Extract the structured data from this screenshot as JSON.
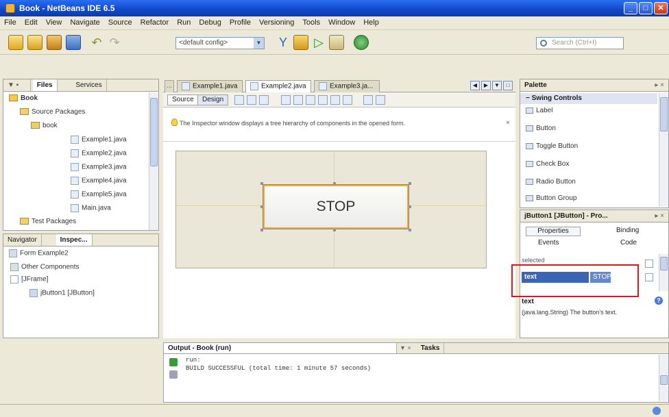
{
  "window": {
    "title": "Book - NetBeans IDE 6.5"
  },
  "menu": [
    "File",
    "Edit",
    "View",
    "Navigate",
    "Source",
    "Refactor",
    "Run",
    "Debug",
    "Profile",
    "Versioning",
    "Tools",
    "Window",
    "Help"
  ],
  "toolbar": {
    "config": "<default config>",
    "search_placeholder": "Search (Ctrl+I)"
  },
  "projects_panel": {
    "tabs": [
      "Files",
      "Services"
    ],
    "tree": [
      {
        "label": "Book",
        "type": "project"
      },
      {
        "label": "Source Packages",
        "type": "folder"
      },
      {
        "label": "book",
        "type": "package"
      },
      {
        "label": "Example1.java",
        "type": "file"
      },
      {
        "label": "Example2.java",
        "type": "file"
      },
      {
        "label": "Example3.java",
        "type": "file"
      },
      {
        "label": "Example4.java",
        "type": "file"
      },
      {
        "label": "Example5.java",
        "type": "file"
      },
      {
        "label": "Main.java",
        "type": "file"
      },
      {
        "label": "Test Packages",
        "type": "folder"
      }
    ]
  },
  "navigator_panel": {
    "tabs": [
      "Navigator",
      "Inspec..."
    ],
    "tree": [
      {
        "label": "Form Example2"
      },
      {
        "label": "Other Components"
      },
      {
        "label": "[JFrame]"
      },
      {
        "label": "jButton1 [JButton]"
      }
    ]
  },
  "editor": {
    "tabs": [
      "Example1.java",
      "Example2.java",
      "Example3.ja..."
    ],
    "views": [
      "Source",
      "Design"
    ],
    "hint": "The Inspector window displays a tree hierarchy of components in the opened form.",
    "button_text": "STOP"
  },
  "palette": {
    "title": "Palette",
    "section": "Swing Controls",
    "items": [
      "Label",
      "Button",
      "Toggle Button",
      "Check Box",
      "Radio Button",
      "Button Group"
    ]
  },
  "properties": {
    "title": "jButton1 [JButton] - Pro...",
    "tabs": [
      "Properties",
      "Binding",
      "Events",
      "Code"
    ],
    "group": "selected",
    "row_name": "text",
    "row_value": "STOP",
    "desc_title": "text",
    "desc_text": "(java.lang.String) The button's text."
  },
  "output": {
    "title": "Output - Book (run)",
    "tabs": [
      "Tasks"
    ],
    "lines": [
      "run:",
      "BUILD SUCCESSFUL (total time: 1 minute 57 seconds)"
    ]
  },
  "colors": {
    "highlight": "#e0141a",
    "selection": "#3c64b4",
    "accent_orange": "#f0a830"
  }
}
